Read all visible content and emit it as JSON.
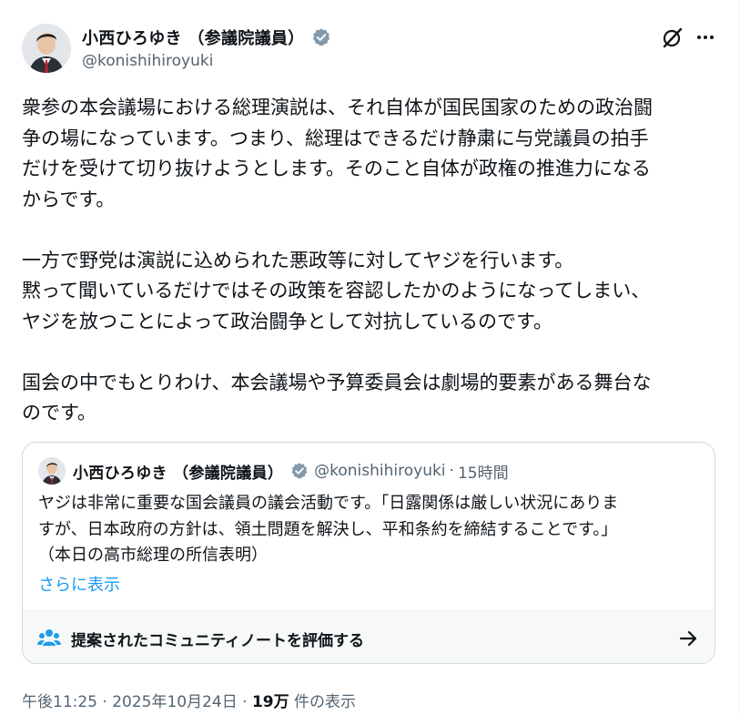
{
  "author": {
    "display_name": "小西ひろゆき （参議院議員）",
    "handle": "@konishihiroyuki"
  },
  "post": {
    "paragraphs": [
      "衆参の本会議場における総理演説は、それ自体が国民国家のための政治闘\n争の場になっています。つまり、総理はできるだけ静粛に与党議員の拍手\nだけを受けて切り抜けようとします。そのこと自体が政権の推進力になる\nからです。",
      "一方で野党は演説に込められた悪政等に対してヤジを行います。\n黙って聞いているだけではその政策を容認したかのようになってしまい、\nヤジを放つことによって政治闘争として対抗しているのです。",
      "国会の中でもとりわけ、本会議場や予算委員会は劇場的要素がある舞台な\nのです。"
    ]
  },
  "quote": {
    "display_name": "小西ひろゆき （参議院議員）",
    "handle": "@konishihiroyuki",
    "separator": "·",
    "time": "15時間",
    "text": "ヤジは非常に重要な国会議員の議会活動です。「日露関係は厳しい状況にありま\nすが、日本政府の方針は、領土問題を解決し、平和条約を締結することです。」\n（本日の高市総理の所信表明）",
    "show_more": "さらに表示",
    "community_note": "提案されたコミュニティノートを評価する"
  },
  "meta": {
    "time": "午後11:25",
    "separator": "·",
    "date": "2025年10月24日",
    "views_count": "19万",
    "views_label": "件の表示"
  },
  "icons": {
    "verified": "verified-badge-icon",
    "grok": "grok-icon",
    "more": "more-icon",
    "community": "people-icon",
    "arrow": "arrow-right-icon"
  },
  "colors": {
    "text": "#0f1419",
    "secondary": "#536471",
    "accent": "#1d9bf0",
    "border": "#cfd9de",
    "badge": "#829aab"
  }
}
